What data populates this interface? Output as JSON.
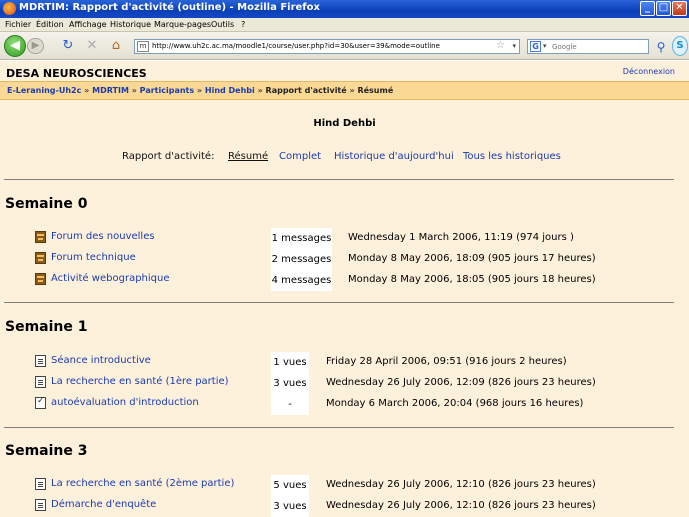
{
  "window": {
    "title": "MDRTIM: Rapport d'activité (outline) - Mozilla Firefox",
    "buttons": {
      "minimize": "_",
      "maximize": "□",
      "close": "✕"
    }
  },
  "menu": [
    "Fichier",
    "Édition",
    "Affichage",
    "Historique",
    "Marque-pages",
    "Outils",
    "?"
  ],
  "toolbar": {
    "url": "http://www.uh2c.ac.ma/moodle1/course/user.php?id=30&user=39&mode=outline",
    "search_placeholder": "Google"
  },
  "page": {
    "site_name": "DESA NEUROSCIENCES",
    "logout": "Déconnexion",
    "breadcrumb": {
      "links": [
        "E-Leraning-Uh2c",
        "MDRTIM",
        "Participants",
        "Hind Dehbi"
      ],
      "plain": [
        "Rapport d'activité",
        "Résumé"
      ],
      "separator": "»"
    },
    "user_name": "Hind Dehbi",
    "report": {
      "label": "Rapport d'activité:",
      "tabs": [
        "Résumé",
        "Complet",
        "Historique d'aujourd'hui",
        "Tous les historiques"
      ]
    },
    "weeks": [
      {
        "title": "Semaine 0",
        "activities": [
          {
            "icon": "forum-icon",
            "name": "Forum des nouvelles",
            "count": "1 messages",
            "date": "Wednesday 1 March 2006, 11:19 (974 jours )"
          },
          {
            "icon": "forum-icon",
            "name": "Forum technique",
            "count": "2 messages",
            "date": "Monday 8 May 2006, 18:09 (905 jours 17 heures)"
          },
          {
            "icon": "forum-icon",
            "name": "Activité webographique",
            "count": "4 messages",
            "date": "Monday 8 May 2006, 18:05 (905 jours 18 heures)"
          }
        ]
      },
      {
        "title": "Semaine 1",
        "activities": [
          {
            "icon": "resource-icon",
            "name": "Séance introductive",
            "count": "1 vues",
            "date": "Friday 28 April 2006, 09:51 (916 jours 2 heures)"
          },
          {
            "icon": "resource-icon",
            "name": "La recherche en santé (1ère partie)",
            "count": "3 vues",
            "date": "Wednesday 26 July 2006, 12:09 (826 jours 23 heures)"
          },
          {
            "icon": "quiz-icon",
            "name": "autoévaluation d'introduction",
            "count": "-",
            "date": "Monday 6 March 2006, 20:04 (968 jours 16 heures)"
          }
        ]
      },
      {
        "title": "Semaine 3",
        "activities": [
          {
            "icon": "resource-icon",
            "name": "La recherche en santé (2ème partie)",
            "count": "5 vues",
            "date": "Wednesday 26 July 2006, 12:10 (826 jours 23 heures)"
          },
          {
            "icon": "resource-icon",
            "name": "Démarche d'enquête",
            "count": "3 vues",
            "date": "Wednesday 26 July 2006, 12:10 (826 jours 23 heures)"
          }
        ]
      }
    ]
  }
}
